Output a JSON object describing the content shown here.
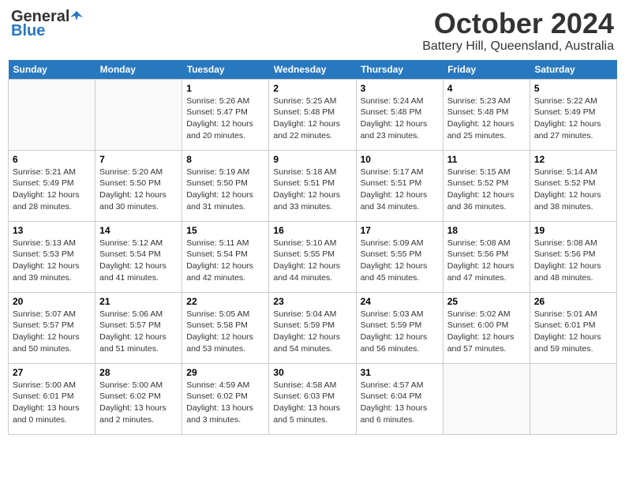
{
  "header": {
    "logo_general": "General",
    "logo_blue": "Blue",
    "title": "October 2024",
    "location": "Battery Hill, Queensland, Australia"
  },
  "days_of_week": [
    "Sunday",
    "Monday",
    "Tuesday",
    "Wednesday",
    "Thursday",
    "Friday",
    "Saturday"
  ],
  "weeks": [
    [
      {
        "day": "",
        "info": ""
      },
      {
        "day": "",
        "info": ""
      },
      {
        "day": "1",
        "info": "Sunrise: 5:26 AM\nSunset: 5:47 PM\nDaylight: 12 hours and 20 minutes."
      },
      {
        "day": "2",
        "info": "Sunrise: 5:25 AM\nSunset: 5:48 PM\nDaylight: 12 hours and 22 minutes."
      },
      {
        "day": "3",
        "info": "Sunrise: 5:24 AM\nSunset: 5:48 PM\nDaylight: 12 hours and 23 minutes."
      },
      {
        "day": "4",
        "info": "Sunrise: 5:23 AM\nSunset: 5:48 PM\nDaylight: 12 hours and 25 minutes."
      },
      {
        "day": "5",
        "info": "Sunrise: 5:22 AM\nSunset: 5:49 PM\nDaylight: 12 hours and 27 minutes."
      }
    ],
    [
      {
        "day": "6",
        "info": "Sunrise: 5:21 AM\nSunset: 5:49 PM\nDaylight: 12 hours and 28 minutes."
      },
      {
        "day": "7",
        "info": "Sunrise: 5:20 AM\nSunset: 5:50 PM\nDaylight: 12 hours and 30 minutes."
      },
      {
        "day": "8",
        "info": "Sunrise: 5:19 AM\nSunset: 5:50 PM\nDaylight: 12 hours and 31 minutes."
      },
      {
        "day": "9",
        "info": "Sunrise: 5:18 AM\nSunset: 5:51 PM\nDaylight: 12 hours and 33 minutes."
      },
      {
        "day": "10",
        "info": "Sunrise: 5:17 AM\nSunset: 5:51 PM\nDaylight: 12 hours and 34 minutes."
      },
      {
        "day": "11",
        "info": "Sunrise: 5:15 AM\nSunset: 5:52 PM\nDaylight: 12 hours and 36 minutes."
      },
      {
        "day": "12",
        "info": "Sunrise: 5:14 AM\nSunset: 5:52 PM\nDaylight: 12 hours and 38 minutes."
      }
    ],
    [
      {
        "day": "13",
        "info": "Sunrise: 5:13 AM\nSunset: 5:53 PM\nDaylight: 12 hours and 39 minutes."
      },
      {
        "day": "14",
        "info": "Sunrise: 5:12 AM\nSunset: 5:54 PM\nDaylight: 12 hours and 41 minutes."
      },
      {
        "day": "15",
        "info": "Sunrise: 5:11 AM\nSunset: 5:54 PM\nDaylight: 12 hours and 42 minutes."
      },
      {
        "day": "16",
        "info": "Sunrise: 5:10 AM\nSunset: 5:55 PM\nDaylight: 12 hours and 44 minutes."
      },
      {
        "day": "17",
        "info": "Sunrise: 5:09 AM\nSunset: 5:55 PM\nDaylight: 12 hours and 45 minutes."
      },
      {
        "day": "18",
        "info": "Sunrise: 5:08 AM\nSunset: 5:56 PM\nDaylight: 12 hours and 47 minutes."
      },
      {
        "day": "19",
        "info": "Sunrise: 5:08 AM\nSunset: 5:56 PM\nDaylight: 12 hours and 48 minutes."
      }
    ],
    [
      {
        "day": "20",
        "info": "Sunrise: 5:07 AM\nSunset: 5:57 PM\nDaylight: 12 hours and 50 minutes."
      },
      {
        "day": "21",
        "info": "Sunrise: 5:06 AM\nSunset: 5:57 PM\nDaylight: 12 hours and 51 minutes."
      },
      {
        "day": "22",
        "info": "Sunrise: 5:05 AM\nSunset: 5:58 PM\nDaylight: 12 hours and 53 minutes."
      },
      {
        "day": "23",
        "info": "Sunrise: 5:04 AM\nSunset: 5:59 PM\nDaylight: 12 hours and 54 minutes."
      },
      {
        "day": "24",
        "info": "Sunrise: 5:03 AM\nSunset: 5:59 PM\nDaylight: 12 hours and 56 minutes."
      },
      {
        "day": "25",
        "info": "Sunrise: 5:02 AM\nSunset: 6:00 PM\nDaylight: 12 hours and 57 minutes."
      },
      {
        "day": "26",
        "info": "Sunrise: 5:01 AM\nSunset: 6:01 PM\nDaylight: 12 hours and 59 minutes."
      }
    ],
    [
      {
        "day": "27",
        "info": "Sunrise: 5:00 AM\nSunset: 6:01 PM\nDaylight: 13 hours and 0 minutes."
      },
      {
        "day": "28",
        "info": "Sunrise: 5:00 AM\nSunset: 6:02 PM\nDaylight: 13 hours and 2 minutes."
      },
      {
        "day": "29",
        "info": "Sunrise: 4:59 AM\nSunset: 6:02 PM\nDaylight: 13 hours and 3 minutes."
      },
      {
        "day": "30",
        "info": "Sunrise: 4:58 AM\nSunset: 6:03 PM\nDaylight: 13 hours and 5 minutes."
      },
      {
        "day": "31",
        "info": "Sunrise: 4:57 AM\nSunset: 6:04 PM\nDaylight: 13 hours and 6 minutes."
      },
      {
        "day": "",
        "info": ""
      },
      {
        "day": "",
        "info": ""
      }
    ]
  ]
}
